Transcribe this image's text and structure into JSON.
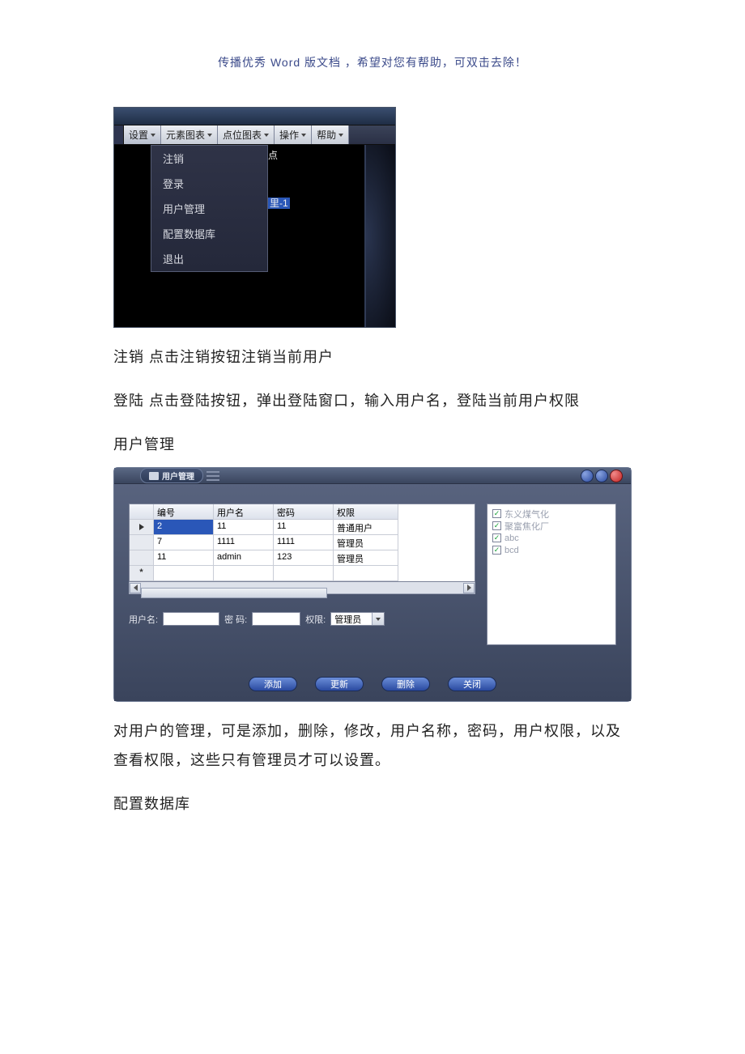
{
  "doc_header": "传播优秀 Word 版文档 ，希望对您有帮助，可双击去除！",
  "shot1": {
    "menubar": [
      "设置",
      "元素图表",
      "点位图表",
      "操作",
      "帮助"
    ],
    "dropdown": [
      "注销",
      "登录",
      "用户管理",
      "配置数据库",
      "退出"
    ],
    "side_labels": {
      "l1": "点",
      "l2": "里-1"
    }
  },
  "para1": "注销 点击注销按钮注销当前用户",
  "para2": "登陆 点击登陆按钮，弹出登陆窗口，输入用户名，登陆当前用户权限",
  "para3": "用户管理",
  "shot2": {
    "title": "用户管理",
    "table": {
      "headers": [
        "编号",
        "用户名",
        "密码",
        "权限"
      ],
      "rows": [
        {
          "id": "2",
          "user": "11",
          "pass": "11",
          "role": "普通用户",
          "selected": true
        },
        {
          "id": "7",
          "user": "1111",
          "pass": "1111",
          "role": "管理员",
          "selected": false
        },
        {
          "id": "11",
          "user": "admin",
          "pass": "123",
          "role": "管理员",
          "selected": false
        }
      ]
    },
    "form": {
      "label_user": "用户名:",
      "label_pass": "密 码:",
      "label_role": "权限:",
      "role_value": "管理员"
    },
    "tree": [
      "东义煤气化",
      "聚富焦化厂",
      "abc",
      "bcd"
    ],
    "buttons": [
      "添加",
      "更新",
      "删除",
      "关闭"
    ]
  },
  "para4": "对用户的管理，可是添加，删除，修改，用户名称，密码，用户权限，以及查看权限，这些只有管理员才可以设置。",
  "para5": "配置数据库"
}
